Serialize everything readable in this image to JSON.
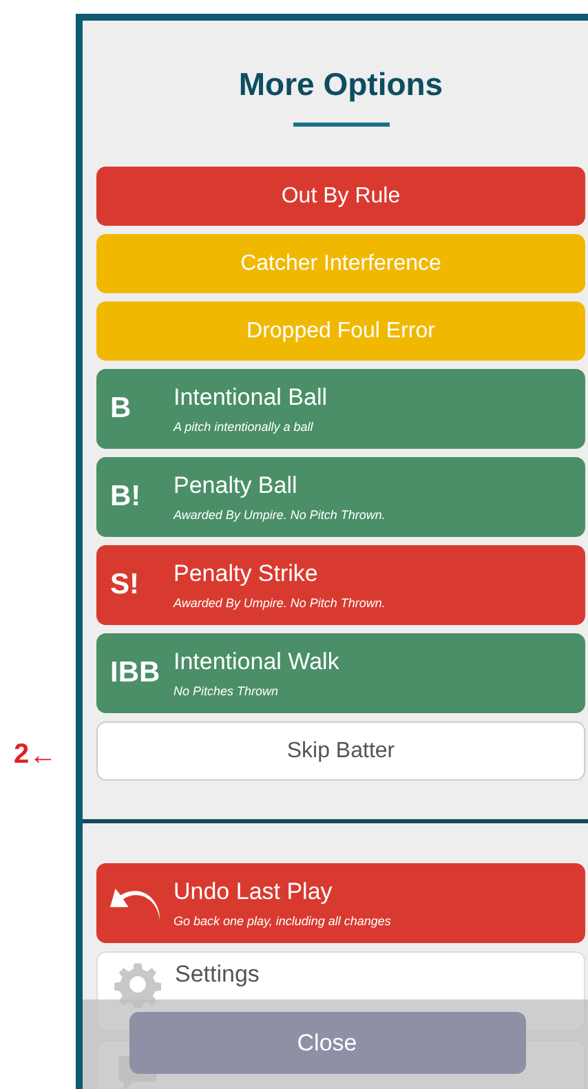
{
  "annotation": {
    "label": "2",
    "arrow": "←"
  },
  "title": "More Options",
  "options": [
    {
      "kind": "plain",
      "label": "Out By Rule",
      "color": "#d93a30"
    },
    {
      "kind": "plain",
      "label": "Catcher Interference",
      "color": "#f0b800"
    },
    {
      "kind": "plain",
      "label": "Dropped Foul Error",
      "color": "#f0b800"
    },
    {
      "kind": "detailed",
      "badge": "B",
      "label": "Intentional Ball",
      "subtitle": "A pitch intentionally a ball",
      "color": "#4a8f67"
    },
    {
      "kind": "detailed",
      "badge": "B!",
      "label": "Penalty Ball",
      "subtitle": "Awarded By Umpire. No Pitch Thrown.",
      "color": "#4a8f67"
    },
    {
      "kind": "detailed",
      "badge": "S!",
      "label": "Penalty Strike",
      "subtitle": "Awarded By Umpire. No Pitch Thrown.",
      "color": "#d93a30"
    },
    {
      "kind": "detailed",
      "badge": "IBB",
      "label": "Intentional Walk",
      "subtitle": "No Pitches Thrown",
      "color": "#4a8f67"
    },
    {
      "kind": "outline",
      "label": "Skip Batter"
    }
  ],
  "actions": [
    {
      "kind": "undo",
      "label": "Undo Last Play",
      "subtitle": "Go back one play, including all changes"
    },
    {
      "kind": "settings",
      "label": "Settings"
    },
    {
      "kind": "message"
    }
  ],
  "close_button": "Close"
}
